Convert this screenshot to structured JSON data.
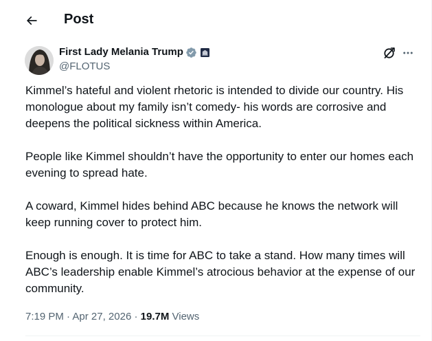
{
  "header": {
    "title": "Post"
  },
  "author": {
    "display_name": "First Lady Melania Trump",
    "handle": "@FLOTUS",
    "verified_color": "#829aab"
  },
  "post": {
    "paragraphs": [
      "Kimmel’s hateful and violent rhetoric is intended to divide our country. His monologue about my family isn’t comedy- his words are corrosive and deepens the political sickness within America.",
      "People like Kimmel shouldn’t have the opportunity to enter our homes each evening to spread hate.",
      "A coward, Kimmel hides behind ABC because he knows the network will keep running cover to protect him.",
      "Enough is enough.  It is time for ABC to take a stand.  How many times will ABC’s leadership enable Kimmel’s atrocious behavior at the expense of our community."
    ],
    "time": "7:19 PM",
    "separator": "·",
    "date": "Apr 27, 2026",
    "views_count": "19.7M",
    "views_label": "Views"
  },
  "icons": {
    "back": "arrow-left-icon",
    "verified": "verified-badge-icon",
    "government": "government-badge-icon",
    "grok": "grok-icon",
    "more": "more-icon"
  }
}
